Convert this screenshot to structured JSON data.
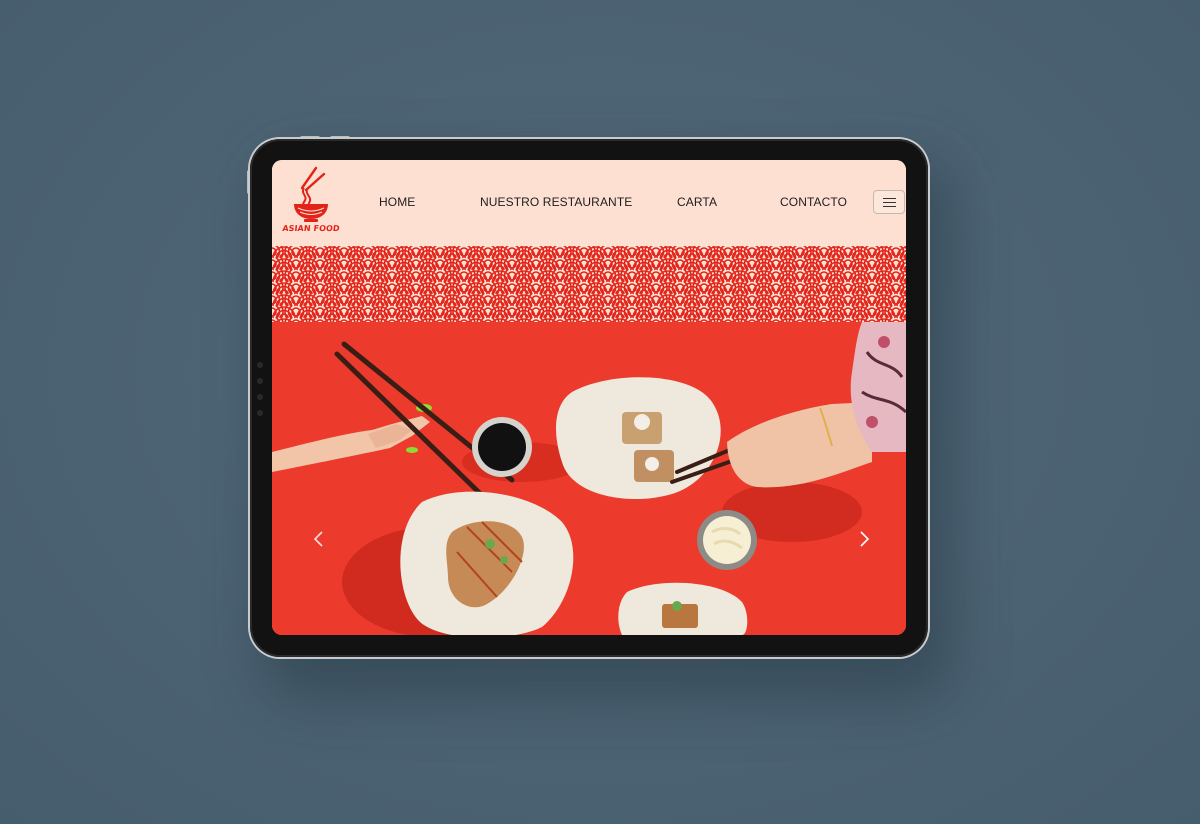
{
  "brand": {
    "name": "ASIAN FOOD",
    "accent_color": "#e2231a",
    "header_bg": "#fde0d2",
    "hero_bg": "#ec3b2c"
  },
  "nav": {
    "items": [
      {
        "label": "HOME"
      },
      {
        "label": "NUESTRO RESTAURANTE"
      },
      {
        "label": "CARTA"
      },
      {
        "label": "CONTACTO"
      }
    ],
    "menu_icon": "hamburger-icon"
  },
  "hero": {
    "image": "food-photo",
    "prev_icon": "chevron-left-icon",
    "next_icon": "chevron-right-icon"
  }
}
